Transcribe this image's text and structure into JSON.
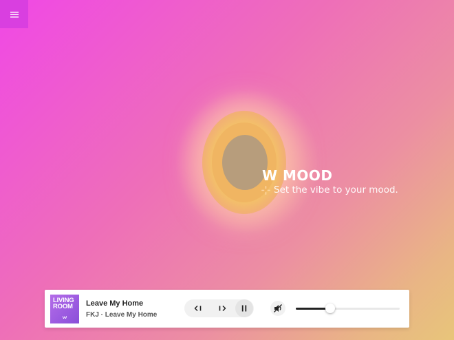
{
  "menu": {
    "icon": "hamburger-menu-icon"
  },
  "hero": {
    "brand": "W MOOD",
    "tagline": "Set the vibe to your mood.",
    "tagline_icon": "sparkle-icon"
  },
  "player": {
    "album_art_text": "LIVING ROOM",
    "track_title": "Leave My Home",
    "track_subtitle": "FKJ · Leave My Home",
    "controls": {
      "prev_icon": "skip-previous-icon",
      "next_icon": "skip-next-icon",
      "pause_icon": "pause-icon",
      "volume_icon": "volume-muted-icon"
    },
    "volume": 0.33
  },
  "colors": {
    "menu_bg": "#d93fe0",
    "bg_start": "#f048e6",
    "bg_end": "#e8c57a",
    "album": "#9b5ae0"
  }
}
